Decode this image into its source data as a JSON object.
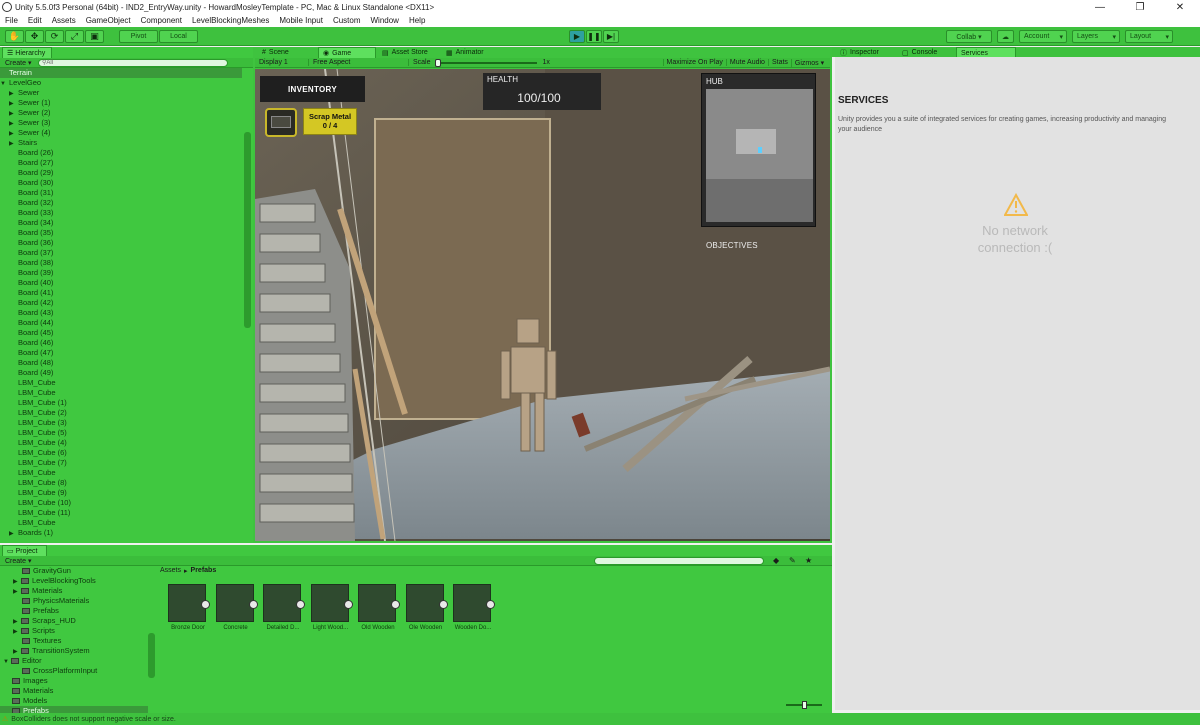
{
  "window": {
    "title": "Unity 5.5.0f3 Personal (64bit) - IND2_EntryWay.unity - HowardMosleyTemplate - PC, Mac & Linux Standalone <DX11>"
  },
  "menu": [
    "File",
    "Edit",
    "Assets",
    "GameObject",
    "Component",
    "LevelBlockingMeshes",
    "Mobile Input",
    "Custom",
    "Window",
    "Help"
  ],
  "toolbar": {
    "pivot": "Pivot",
    "local": "Local",
    "collab": "Collab ▾",
    "account": "Account",
    "layers": "Layers",
    "layout": "Layout"
  },
  "hierarchy": {
    "tab": "Hierarchy",
    "create": "Create ▾",
    "search_placeholder": "All",
    "items": [
      {
        "label": "Terrain",
        "indent": 1,
        "selected": true
      },
      {
        "label": "LevelGeo",
        "indent": 1,
        "arrow": "▼"
      },
      {
        "label": "Sewer",
        "indent": 2,
        "arrow": "▶"
      },
      {
        "label": "Sewer (1)",
        "indent": 2,
        "arrow": "▶"
      },
      {
        "label": "Sewer (2)",
        "indent": 2,
        "arrow": "▶"
      },
      {
        "label": "Sewer (3)",
        "indent": 2,
        "arrow": "▶"
      },
      {
        "label": "Sewer (4)",
        "indent": 2,
        "arrow": "▶"
      },
      {
        "label": "Stairs",
        "indent": 2,
        "arrow": "▶"
      },
      {
        "label": "Board (26)",
        "indent": 2
      },
      {
        "label": "Board (27)",
        "indent": 2
      },
      {
        "label": "Board (29)",
        "indent": 2
      },
      {
        "label": "Board (30)",
        "indent": 2
      },
      {
        "label": "Board (31)",
        "indent": 2
      },
      {
        "label": "Board (32)",
        "indent": 2
      },
      {
        "label": "Board (33)",
        "indent": 2
      },
      {
        "label": "Board (34)",
        "indent": 2
      },
      {
        "label": "Board (35)",
        "indent": 2
      },
      {
        "label": "Board (36)",
        "indent": 2
      },
      {
        "label": "Board (37)",
        "indent": 2
      },
      {
        "label": "Board (38)",
        "indent": 2
      },
      {
        "label": "Board (39)",
        "indent": 2
      },
      {
        "label": "Board (40)",
        "indent": 2
      },
      {
        "label": "Board (41)",
        "indent": 2
      },
      {
        "label": "Board (42)",
        "indent": 2
      },
      {
        "label": "Board (43)",
        "indent": 2
      },
      {
        "label": "Board (44)",
        "indent": 2
      },
      {
        "label": "Board (45)",
        "indent": 2
      },
      {
        "label": "Board (46)",
        "indent": 2
      },
      {
        "label": "Board (47)",
        "indent": 2
      },
      {
        "label": "Board (48)",
        "indent": 2
      },
      {
        "label": "Board (49)",
        "indent": 2
      },
      {
        "label": "LBM_Cube",
        "indent": 2
      },
      {
        "label": "LBM_Cube",
        "indent": 2
      },
      {
        "label": "LBM_Cube (1)",
        "indent": 2
      },
      {
        "label": "LBM_Cube (2)",
        "indent": 2
      },
      {
        "label": "LBM_Cube (3)",
        "indent": 2
      },
      {
        "label": "LBM_Cube (5)",
        "indent": 2
      },
      {
        "label": "LBM_Cube (4)",
        "indent": 2
      },
      {
        "label": "LBM_Cube (6)",
        "indent": 2
      },
      {
        "label": "LBM_Cube (7)",
        "indent": 2
      },
      {
        "label": "LBM_Cube",
        "indent": 2
      },
      {
        "label": "LBM_Cube (8)",
        "indent": 2
      },
      {
        "label": "LBM_Cube (9)",
        "indent": 2
      },
      {
        "label": "LBM_Cube (10)",
        "indent": 2
      },
      {
        "label": "LBM_Cube (11)",
        "indent": 2
      },
      {
        "label": "LBM_Cube",
        "indent": 2
      },
      {
        "label": "Boards (1)",
        "indent": 2,
        "arrow": "▶"
      }
    ]
  },
  "center_tabs": [
    {
      "label": "Scene",
      "icon": "#"
    },
    {
      "label": "Game",
      "icon": "◉",
      "active": true
    },
    {
      "label": "Asset Store",
      "icon": "▤"
    },
    {
      "label": "Animator",
      "icon": "▦"
    }
  ],
  "game_bar": {
    "display": "Display 1",
    "aspect": "Free Aspect",
    "scale_label": "Scale",
    "scale_value": "1x",
    "maximize": "Maximize On Play",
    "mute": "Mute Audio",
    "stats": "Stats",
    "gizmos": "Gizmos ▾"
  },
  "hud": {
    "inventory": "INVENTORY",
    "item_name": "Scrap Metal",
    "item_count": "0 / 4",
    "health_label": "HEALTH",
    "health_value": "100/100",
    "hub": "HUB",
    "objectives": "OBJECTIVES"
  },
  "right_tabs": [
    {
      "label": "Inspector",
      "icon": "ⓘ"
    },
    {
      "label": "Console",
      "icon": "▢"
    },
    {
      "label": "Services",
      "active": true
    }
  ],
  "services": {
    "title": "SERVICES",
    "desc": "Unity provides you a suite of integrated services for creating games, increasing productivity and managing your audience",
    "no_network": "No network connection :("
  },
  "project": {
    "tab": "Project",
    "create": "Create ▾",
    "tree": [
      {
        "label": "GravityGun",
        "indent": 2,
        "folder": true
      },
      {
        "label": "LevelBlockingTools",
        "indent": 2,
        "folder": true,
        "arrow": "▶"
      },
      {
        "label": "Materials",
        "indent": 2,
        "folder": true,
        "arrow": "▶"
      },
      {
        "label": "PhysicsMaterials",
        "indent": 2,
        "folder": true
      },
      {
        "label": "Prefabs",
        "indent": 2,
        "folder": true
      },
      {
        "label": "Scraps_HUD",
        "indent": 2,
        "folder": true,
        "arrow": "▶"
      },
      {
        "label": "Scripts",
        "indent": 2,
        "folder": true,
        "arrow": "▶"
      },
      {
        "label": "Textures",
        "indent": 2,
        "folder": true
      },
      {
        "label": "TransitionSystem",
        "indent": 2,
        "folder": true,
        "arrow": "▶"
      },
      {
        "label": "Editor",
        "indent": 1,
        "folder": true,
        "arrow": "▼"
      },
      {
        "label": "CrossPlatformInput",
        "indent": 2,
        "folder": true
      },
      {
        "label": "Images",
        "indent": 1,
        "folder": true
      },
      {
        "label": "Materials",
        "indent": 1,
        "folder": true
      },
      {
        "label": "Models",
        "indent": 1,
        "folder": true
      },
      {
        "label": "Prefabs",
        "indent": 1,
        "folder": true,
        "selected": true
      }
    ],
    "breadcrumb": {
      "root": "Assets",
      "sep": "▸",
      "current": "Prefabs"
    },
    "assets": [
      "Bronze Door",
      "Concrete",
      "Detailed D...",
      "Light Wood...",
      "Old Wooden",
      "Ole Wooden",
      "Wooden Do..."
    ]
  },
  "status": "BoxColliders does not support negative scale or size.",
  "colors": {
    "panel": "#40c840",
    "toolbar": "#3ec13e",
    "hud_item": "#d4c724"
  }
}
